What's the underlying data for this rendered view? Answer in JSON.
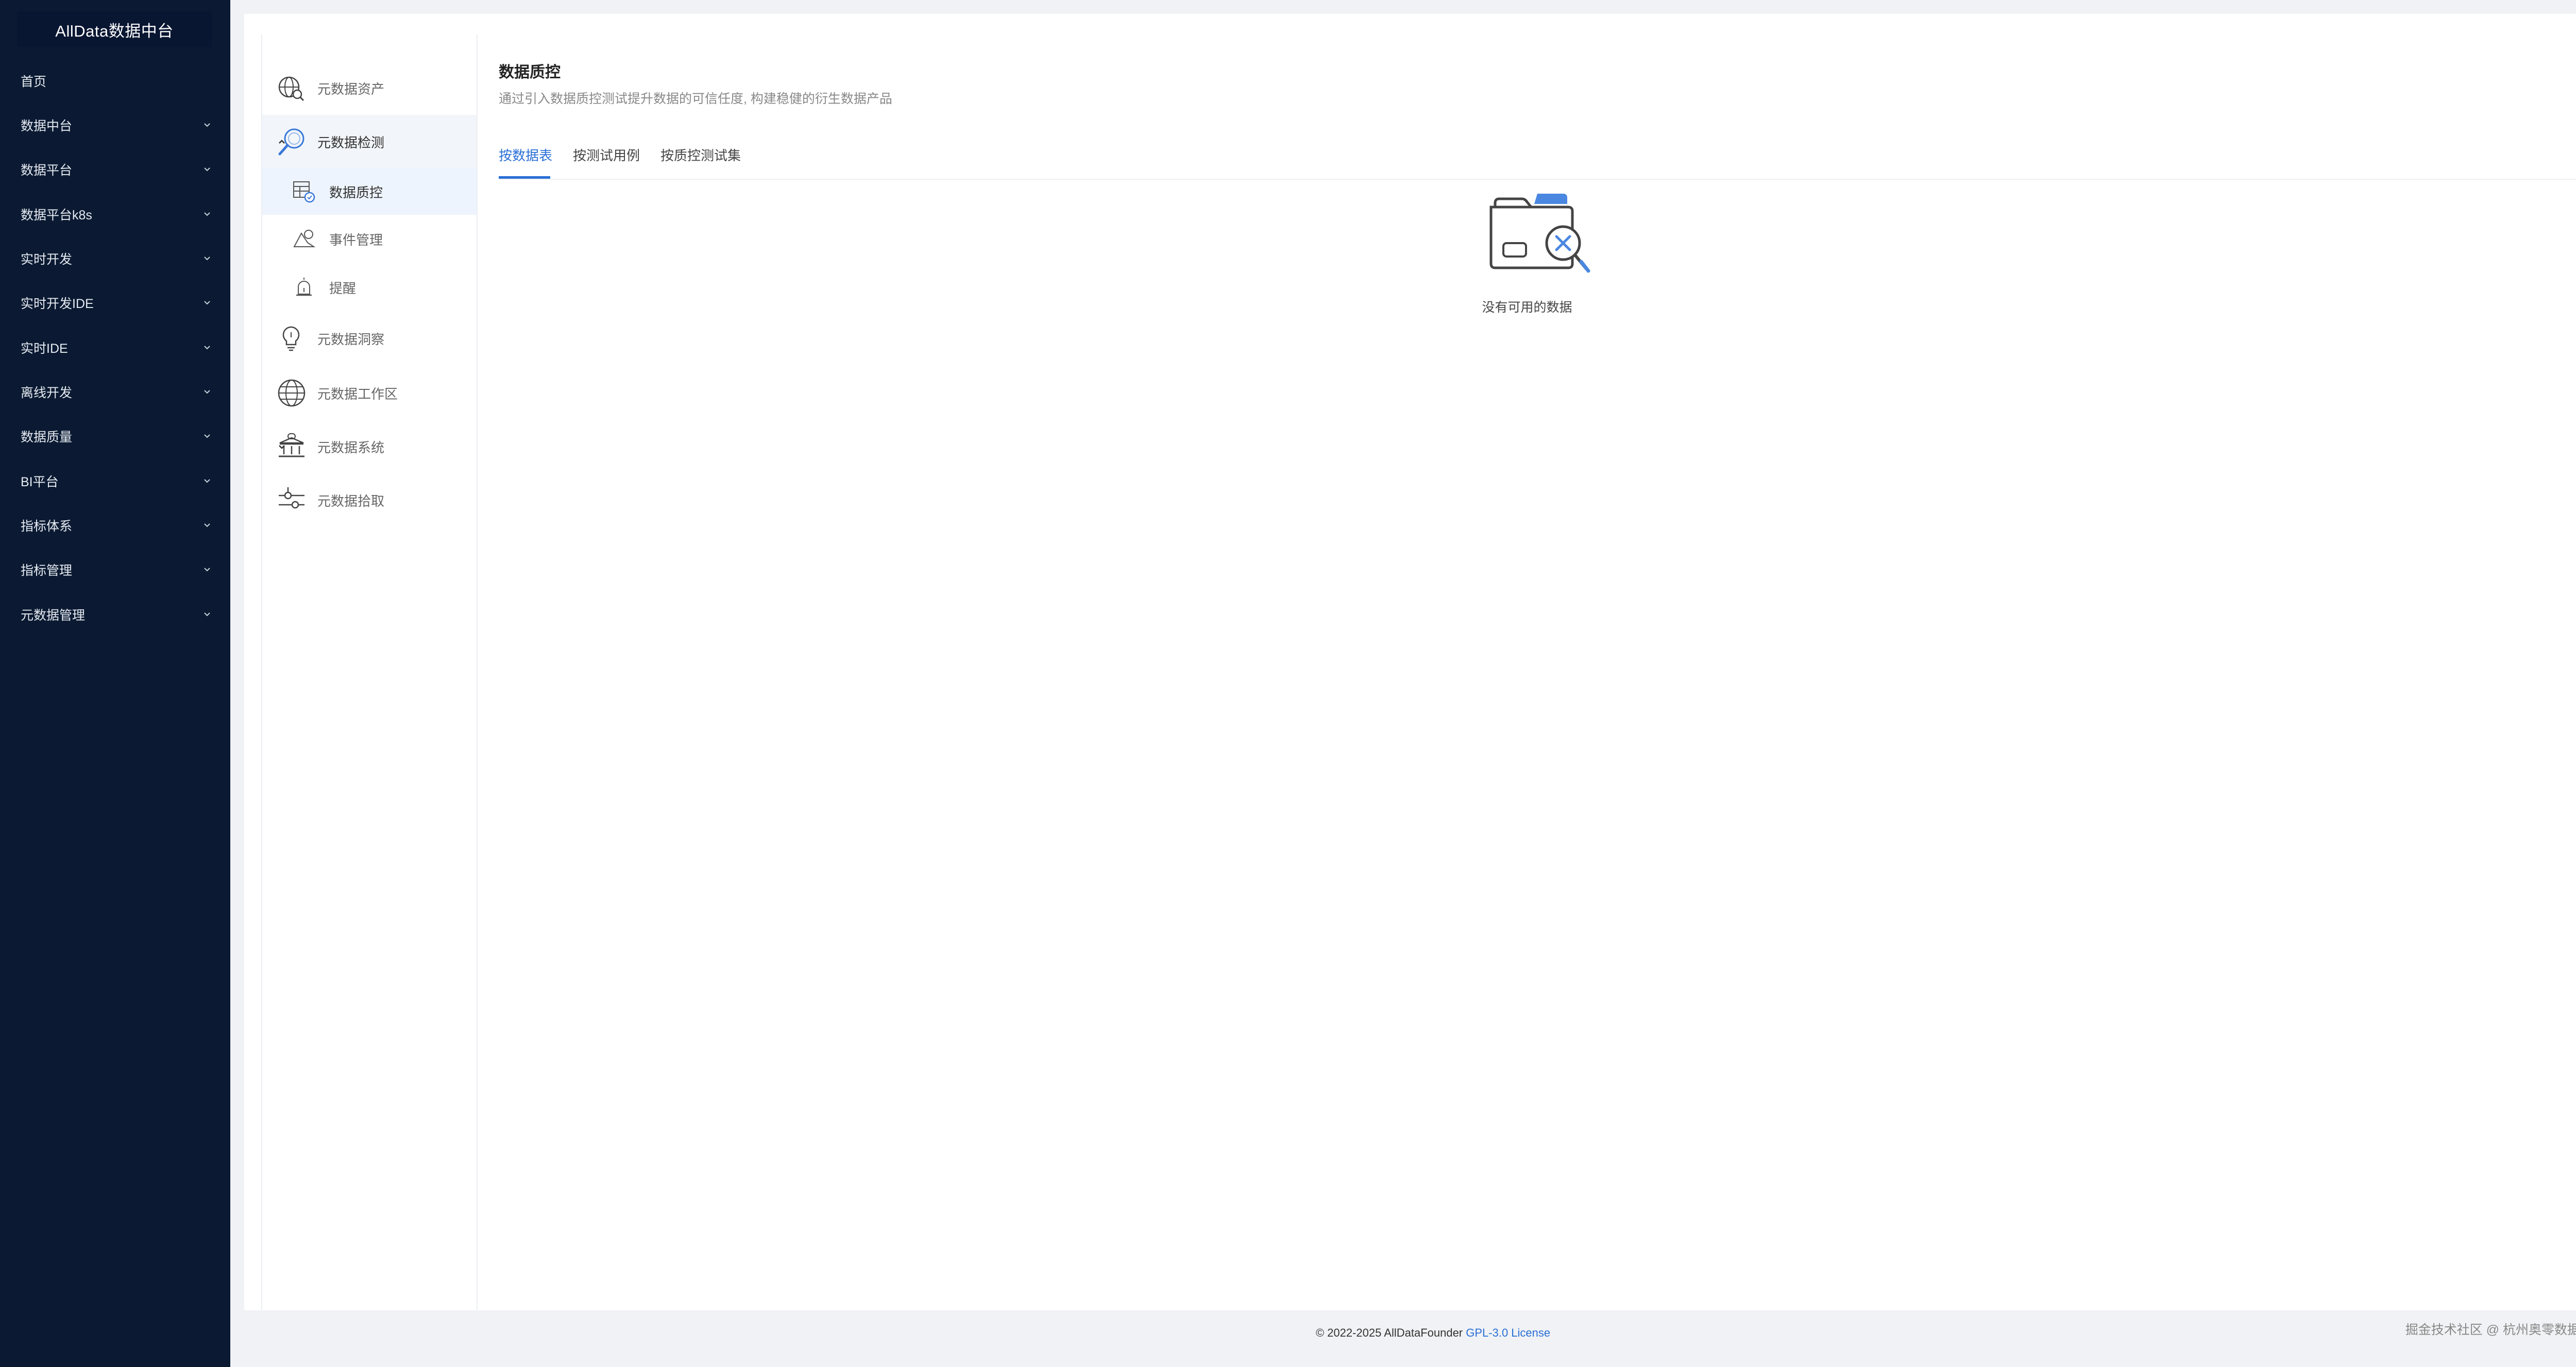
{
  "app": {
    "logo_text": "AllData数据中台"
  },
  "sidebar": {
    "items": [
      {
        "label": "首页",
        "has_children": false
      },
      {
        "label": "数据中台",
        "has_children": true
      },
      {
        "label": "数据平台",
        "has_children": true
      },
      {
        "label": "数据平台k8s",
        "has_children": true
      },
      {
        "label": "实时开发",
        "has_children": true
      },
      {
        "label": "实时开发IDE",
        "has_children": true
      },
      {
        "label": "实时IDE",
        "has_children": true
      },
      {
        "label": "离线开发",
        "has_children": true
      },
      {
        "label": "数据质量",
        "has_children": true
      },
      {
        "label": "BI平台",
        "has_children": true
      },
      {
        "label": "指标体系",
        "has_children": true
      },
      {
        "label": "指标管理",
        "has_children": true
      },
      {
        "label": "元数据管理",
        "has_children": true
      }
    ]
  },
  "subnav": {
    "items": [
      {
        "label": "元数据资产",
        "icon": "globe-search-icon"
      },
      {
        "label": "元数据检测",
        "icon": "magnifier-icon",
        "expanded": true
      },
      {
        "label": "数据质控",
        "icon": "table-check-icon",
        "child": true,
        "selected": true
      },
      {
        "label": "事件管理",
        "icon": "event-icon",
        "child": true
      },
      {
        "label": "提醒",
        "icon": "alarm-icon",
        "child": true
      },
      {
        "label": "元数据洞察",
        "icon": "bulb-icon"
      },
      {
        "label": "元数据工作区",
        "icon": "globe-icon"
      },
      {
        "label": "元数据系统",
        "icon": "bank-icon",
        "collapsible": true
      },
      {
        "label": "元数据拾取",
        "icon": "sliders-icon"
      }
    ]
  },
  "main": {
    "title": "数据质控",
    "description": "通过引入数据质控测试提升数据的可信任度, 构建稳健的衍生数据产品",
    "tabs": [
      {
        "label": "按数据表",
        "active": true
      },
      {
        "label": "按测试用例",
        "active": false
      },
      {
        "label": "按质控测试集",
        "active": false
      }
    ],
    "empty_text": "没有可用的数据"
  },
  "footer": {
    "copyright": "© 2022-2025 AllDataFounder",
    "license": "GPL-3.0 License"
  },
  "watermark": "掘金技术社区 @ 杭州奥零数据科技",
  "colors": {
    "sidebar_bg": "#0b1a32",
    "accent": "#2a6fd6",
    "selected_bg": "#eef4fd"
  }
}
